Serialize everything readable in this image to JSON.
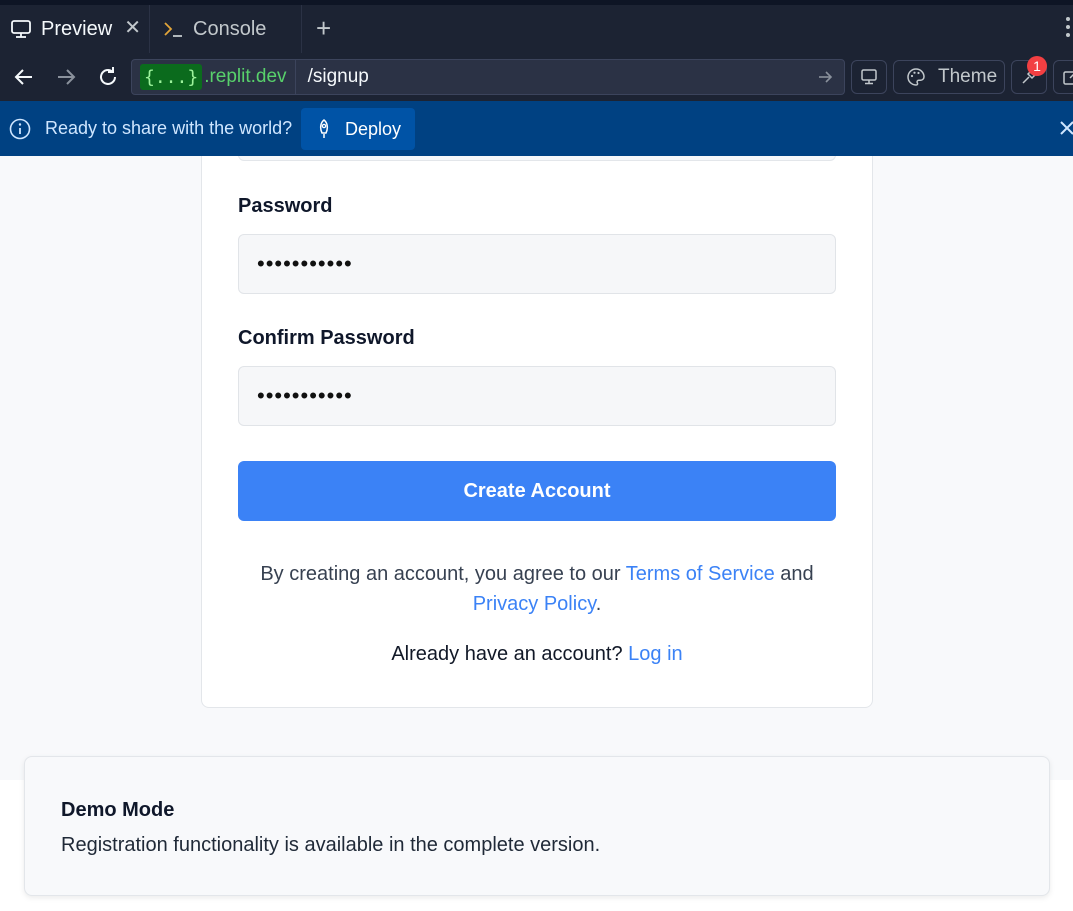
{
  "tabs": [
    {
      "label": "Preview",
      "icon": "monitor-icon"
    },
    {
      "label": "Console",
      "icon": "terminal-icon"
    }
  ],
  "address": {
    "badge": "{...}",
    "host": ".replit.dev",
    "path": "/signup"
  },
  "toolbar": {
    "theme_label": "Theme",
    "notification_count": "1"
  },
  "banner": {
    "text": "Ready to share with the world?",
    "deploy_label": "Deploy"
  },
  "form": {
    "password_label": "Password",
    "password_value": "•••••••••••",
    "confirm_label": "Confirm Password",
    "confirm_value": "•••••••••••",
    "submit_label": "Create Account",
    "terms_prefix": "By creating an account, you agree to our ",
    "terms_link": "Terms of Service",
    "terms_and": " and",
    "privacy_link": "Privacy Policy",
    "privacy_suffix": ".",
    "login_prompt": "Already have an account? ",
    "login_link": "Log in"
  },
  "toast": {
    "title": "Demo Mode",
    "message": "Registration functionality is available in the complete version."
  },
  "colors": {
    "primary": "#3b82f6",
    "banner": "#004182",
    "chrome": "#1c2333"
  }
}
